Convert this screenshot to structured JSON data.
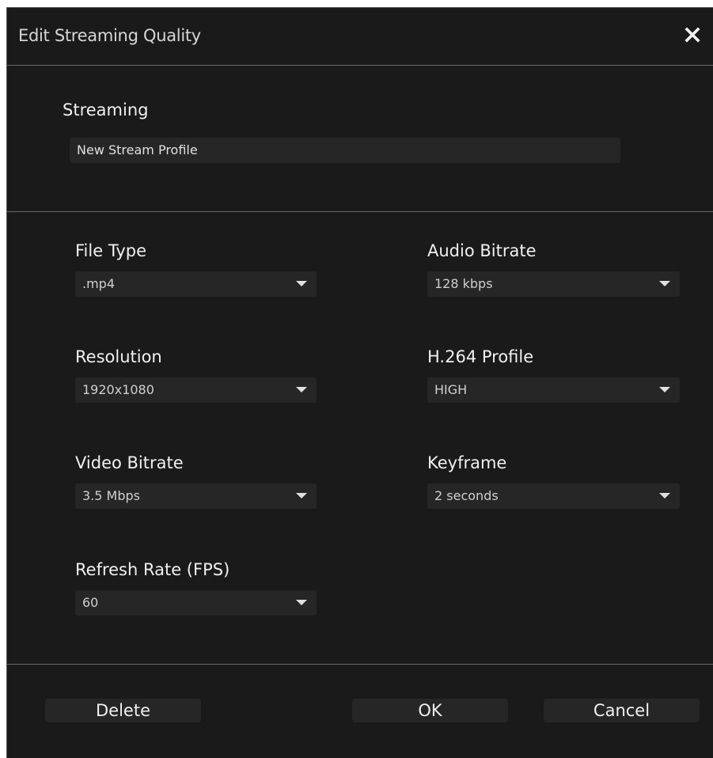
{
  "dialog": {
    "title": "Edit Streaming Quality",
    "close_icon": "close-icon"
  },
  "streaming": {
    "label": "Streaming",
    "profile_name": "New Stream Profile"
  },
  "fields": {
    "file_type": {
      "label": "File Type",
      "value": ".mp4"
    },
    "resolution": {
      "label": "Resolution",
      "value": "1920x1080"
    },
    "video_bitrate": {
      "label": "Video Bitrate",
      "value": "3.5 Mbps"
    },
    "refresh_rate": {
      "label": "Refresh Rate (FPS)",
      "value": "60"
    },
    "audio_bitrate": {
      "label": "Audio Bitrate",
      "value": "128 kbps"
    },
    "h264_profile": {
      "label": "H.264 Profile",
      "value": "HIGH"
    },
    "keyframe": {
      "label": "Keyframe",
      "value": "2 seconds"
    }
  },
  "buttons": {
    "delete": "Delete",
    "ok": "OK",
    "cancel": "Cancel"
  },
  "colors": {
    "background": "#1a1a1a",
    "field_background": "#262626",
    "divider": "#6a6a6a",
    "text": "#f0f0f0"
  }
}
